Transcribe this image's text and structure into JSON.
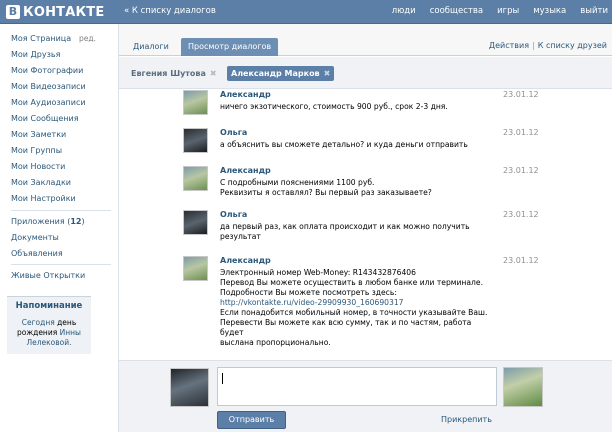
{
  "header": {
    "logo_letter": "B",
    "logo_text": "КОНТАКТЕ",
    "back_link": "« К списку диалогов",
    "nav": [
      "люди",
      "сообщества",
      "игры",
      "музыка",
      "выйти"
    ]
  },
  "sidebar": {
    "edit_label": "ред.",
    "items": [
      "Моя Страница",
      "Мои Друзья",
      "Мои Фотографии",
      "Мои Видеозаписи",
      "Мои Аудиозаписи",
      "Мои Сообщения",
      "Мои Заметки",
      "Мои Группы",
      "Мои Новости",
      "Мои Закладки",
      "Мои Настройки"
    ],
    "apps_label": "Приложения",
    "apps_count": "12",
    "documents": "Документы",
    "ads": "Объявления",
    "live_cards": "Живые Открытки",
    "reminder": {
      "title": "Напоминание",
      "today": "Сегодня",
      "birthday_of": "день",
      "birthday_word": "рождения",
      "name1": "Инны",
      "name2": "Лелековой."
    }
  },
  "tabs": {
    "dialogs": "Диалоги",
    "view_dialogs": "Просмотр диалогов",
    "actions": "Действия",
    "to_friends": "К списку друзей"
  },
  "people": {
    "first": "Евгения Шутова",
    "second": "Александр Марков"
  },
  "messages": [
    {
      "author": "Александр",
      "date": "23.01.12",
      "lines": [
        "ничего экзотического, стоимость 900 руб., срок 2-3 дня."
      ]
    },
    {
      "author": "Ольга",
      "date": "23.01.12",
      "lines": [
        "а объяснить вы сможете детально? и куда деньги отправить"
      ]
    },
    {
      "author": "Александр",
      "date": "23.01.12",
      "lines": [
        "С подробными пояснениями 1100 руб.",
        "Реквизиты я оставлял? Вы первый раз заказываете?"
      ]
    },
    {
      "author": "Ольга",
      "date": "23.01.12",
      "lines": [
        "да первый раз, как оплата происходит и как можно получить",
        "результат"
      ]
    },
    {
      "author": "Александр",
      "date": "23.01.12",
      "lines": [
        "Электронный номер Web-Money: R143432876406",
        "Перевод Вы можете осуществить в любом банке или терминале.",
        "Подробности Вы можете посмотреть здесь:",
        "http://vkontakte.ru/video-29909930_160690317",
        "Если понадобится мобильный номер, в точности указывайте Ваш.",
        "Перевести Вы можете как всю сумму, так и по частям, работа",
        "будет",
        "выслана пропорционально."
      ]
    }
  ],
  "reply": {
    "send": "Отправить",
    "attach": "Прикрепить"
  },
  "icons": {
    "close": "close-icon",
    "logo": "vk-logo-icon"
  },
  "colors": {
    "header": "#5b7fa6",
    "link": "#2b587a",
    "active_tab": "#6d8fb3"
  }
}
